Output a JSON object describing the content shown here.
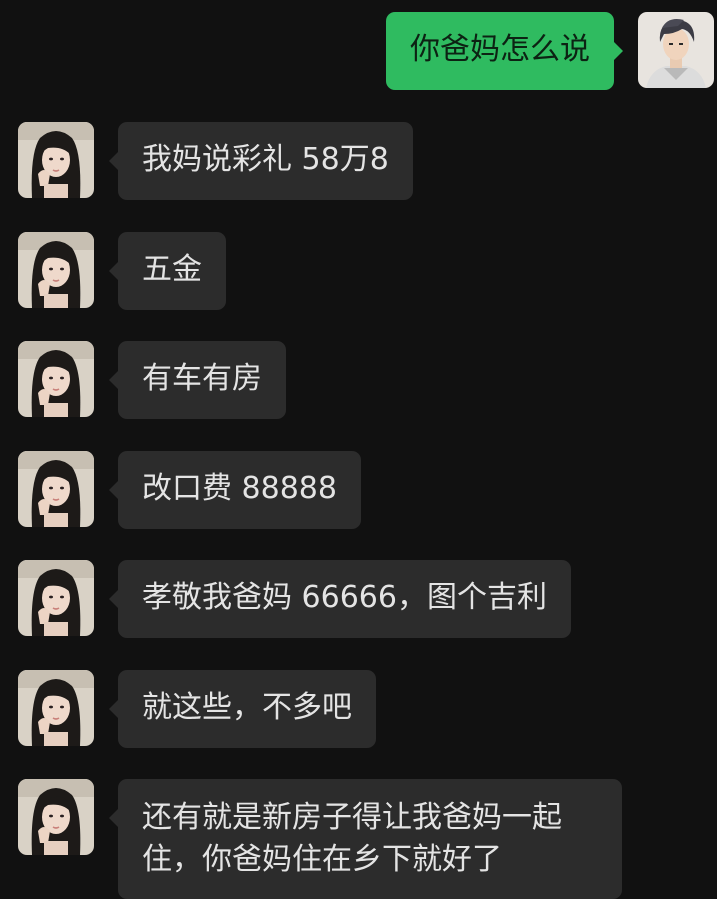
{
  "colors": {
    "background": "#111111",
    "incoming_bubble": "#2c2c2c",
    "outgoing_bubble": "#2fbb60",
    "incoming_text": "#e4e4e4",
    "outgoing_text": "#0c2213"
  },
  "me": {
    "avatar": "male-anime-avatar"
  },
  "contact": {
    "avatar": "female-photo-avatar"
  },
  "messages": [
    {
      "from": "me",
      "text": "你爸妈怎么说"
    },
    {
      "from": "contact",
      "text": "我妈说彩礼 58万8"
    },
    {
      "from": "contact",
      "text": "五金"
    },
    {
      "from": "contact",
      "text": "有车有房"
    },
    {
      "from": "contact",
      "text": "改口费 88888"
    },
    {
      "from": "contact",
      "text": "孝敬我爸妈 66666，图个吉利"
    },
    {
      "from": "contact",
      "text": "就这些，不多吧"
    },
    {
      "from": "contact",
      "text": "还有就是新房子得让我爸妈一起住，你爸妈住在乡下就好了"
    }
  ]
}
